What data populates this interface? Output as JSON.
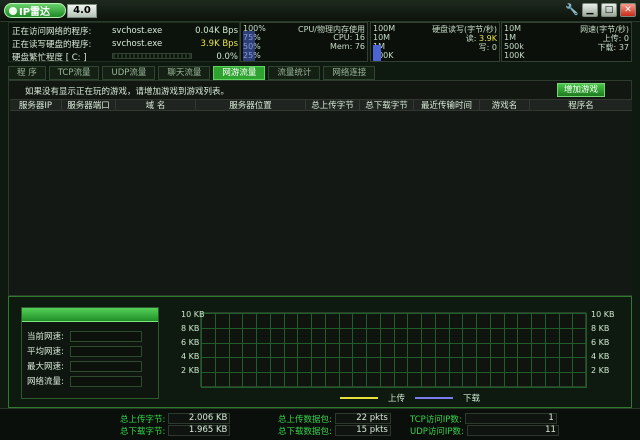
{
  "title_bar": {
    "app_name": "IP雷达",
    "version": "4.0",
    "icons": [
      "wrench-icon",
      "minimize-icon",
      "maximize-icon",
      "close-icon"
    ]
  },
  "status": {
    "rows": [
      {
        "label": "正在访问网络的程序:",
        "value": "svchost.exe",
        "rate": "0.04K Bps",
        "rate_color": "#d8ead8"
      },
      {
        "label": "正在读写硬盘的程序:",
        "value": "svchost.exe",
        "rate": "3.9K Bps",
        "rate_color": "#e7e34a"
      },
      {
        "label": "硬盘繁忙程度 [ C: ]",
        "value": "",
        "rate": "0.0%",
        "rate_color": "#d8ead8"
      }
    ]
  },
  "panels": {
    "cpu": {
      "top_left": "100%",
      "mid_left": "75%",
      "lower_left": "50%",
      "bottom_left": "25%",
      "title": "CPU/物理内存使用",
      "cpu_label": "CPU:",
      "cpu_value": "16",
      "mem_label": "Mem:",
      "mem_value": "76"
    },
    "disk": {
      "top_left": "100M",
      "mid_left": "10M",
      "lower_left": "1M",
      "bottom_left": "100K",
      "title": "硬盘读写(字节/秒)",
      "read_label": "读:",
      "read_value": "3.9K",
      "write_label": "写:",
      "write_value": "0"
    },
    "net": {
      "top_left": "10M",
      "mid_left": "1M",
      "lower_left": "500k",
      "bottom_left": "100K",
      "title": "网速(字节/秒)",
      "up_label": "上传:",
      "up_value": "0",
      "down_label": "下载:",
      "down_value": "37"
    }
  },
  "tabs": [
    {
      "label": "程 序",
      "active": false
    },
    {
      "label": "TCP流量",
      "active": false
    },
    {
      "label": "UDP流量",
      "active": false
    },
    {
      "label": "聊天流量",
      "active": false
    },
    {
      "label": "网游流量",
      "active": true
    },
    {
      "label": "流量统计",
      "active": false
    },
    {
      "label": "网络连接",
      "active": false
    }
  ],
  "tab_content": {
    "hint": "如果没有显示正在玩的游戏，请增加游戏到游戏列表。",
    "add_game_button": "增加游戏",
    "columns": [
      "服务器IP",
      "服务器端口",
      "域 名",
      "服务器位置",
      "总上传字节",
      "总下载字节",
      "最近传输时间",
      "游戏名",
      "程序名"
    ]
  },
  "speed_panel": {
    "rows": [
      {
        "label": "当前网速:",
        "value": ""
      },
      {
        "label": "平均网速:",
        "value": ""
      },
      {
        "label": "最大网速:",
        "value": ""
      },
      {
        "label": "网络流量:",
        "value": ""
      }
    ]
  },
  "chart_data": {
    "type": "line",
    "title": "",
    "xlabel": "",
    "ylabel": "",
    "ylim": [
      0,
      10
    ],
    "y_ticks": [
      "10 KB",
      "8 KB",
      "6 KB",
      "4 KB",
      "2 KB"
    ],
    "series": [
      {
        "name": "上传",
        "values": []
      },
      {
        "name": "下载",
        "values": []
      }
    ],
    "colors": {
      "upload": "#e7df3a",
      "download": "#7b7cf0",
      "grid": "#1e5e2a"
    },
    "legend": "bottom-center",
    "grid": true
  },
  "footer": {
    "total_upload_bytes_label": "总上传字节:",
    "total_upload_bytes": "2.006 KB",
    "total_download_bytes_label": "总下载字节:",
    "total_download_bytes": "1.965 KB",
    "total_upload_packets_label": "总上传数据包:",
    "total_upload_packets": "22 pkts",
    "total_download_packets_label": "总下载数据包:",
    "total_download_packets": "15 pkts",
    "tcp_ip_label": "TCP访问IP数:",
    "tcp_ip_count": "1",
    "udp_ip_label": "UDP访问IP数:",
    "udp_ip_count": "11"
  }
}
